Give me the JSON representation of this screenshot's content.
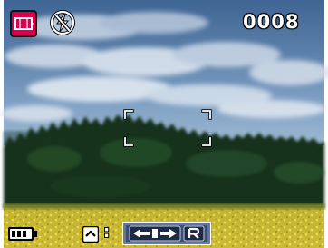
{
  "viewfinder": {
    "shot_count": "0008",
    "shooting_mode_icon": "panorama-mode-icon",
    "flash_icon": "flash-off-icon",
    "focus_frame_icon": "focus-brackets-icon",
    "battery_icon": "battery-icon",
    "up_key_icon": "up-arrow-key-icon",
    "separator": ":",
    "control_icons": [
      "left-right-arrows-icon",
      "r-key-icon"
    ],
    "colors": {
      "mode_icon_bg": "#d9004f",
      "osd_text": "#ffffff",
      "panel_bg": "#3b4e73"
    }
  }
}
